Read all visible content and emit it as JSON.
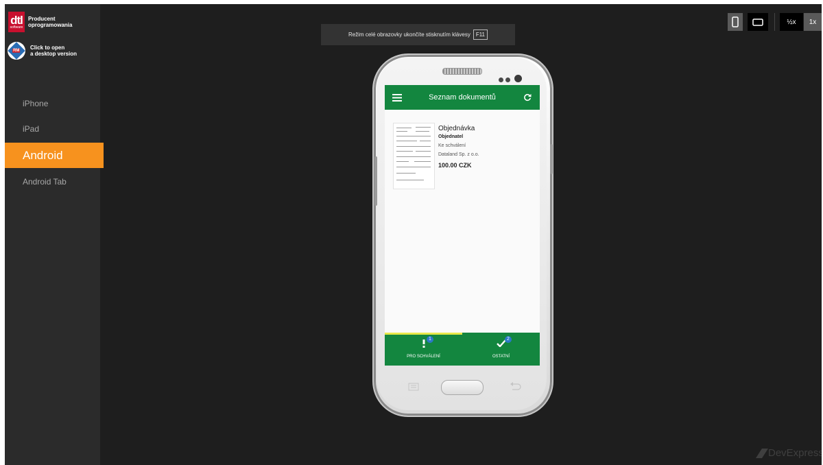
{
  "brand": {
    "logo_big": "dtl",
    "logo_small": "software",
    "tagline_line1": "Producent",
    "tagline_line2": "oprogramowania",
    "desktop_badge": "RM",
    "desktop_line1": "Click to open",
    "desktop_line2": "a desktop version"
  },
  "sidebar": {
    "items": [
      {
        "label": "iPhone"
      },
      {
        "label": "iPad"
      },
      {
        "label": "Android"
      },
      {
        "label": "Android Tab"
      }
    ],
    "active_index": 2
  },
  "notice": {
    "text": "Režim celé obrazovky ukončíte stisknutím klávesy",
    "key": "F11"
  },
  "toolbar": {
    "portrait_icon": "portrait-phone-icon",
    "landscape_icon": "landscape-phone-icon",
    "half_scale": "½x",
    "full_scale": "1x"
  },
  "app": {
    "title": "Seznam dokumentů",
    "menu_icon": "hamburger-menu-icon",
    "refresh_icon": "refresh-icon",
    "document": {
      "type": "Objednávka",
      "party": "Objednatel",
      "status": "Ke schválení",
      "company": "Dataland Sp. z o.o.",
      "amount": "100.00 CZK"
    },
    "tabs": [
      {
        "label": "PRO SCHVÁLENÍ",
        "badge": "1",
        "icon": "exclamation-icon"
      },
      {
        "label": "OSTATNÍ",
        "badge": "2",
        "icon": "checkmark-icon"
      }
    ]
  },
  "watermark": "DevExpress",
  "colors": {
    "accent": "#f7921e",
    "app_green": "#13863f",
    "background": "#1e1e1e",
    "sidebar": "#2b2b2b"
  }
}
